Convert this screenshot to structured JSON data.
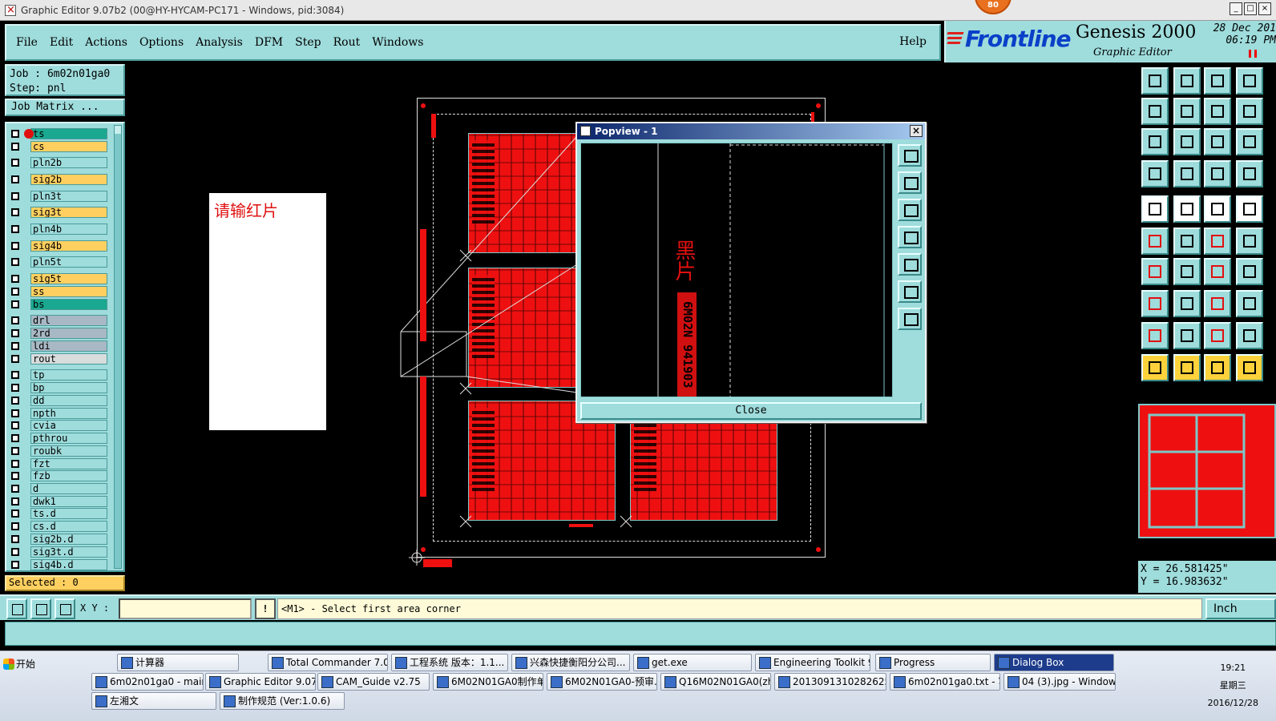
{
  "window": {
    "title": "Graphic Editor 9.07b2 (00@HY-HYCAM-PC171 - Windows, pid:3084)",
    "badge": "80",
    "controls": [
      "_",
      "□",
      "×"
    ]
  },
  "menu": {
    "items": [
      "File",
      "Edit",
      "Actions",
      "Options",
      "Analysis",
      "DFM",
      "Step",
      "Rout",
      "Windows"
    ],
    "help": "Help"
  },
  "branding": {
    "logo": "Frontline",
    "product": "Genesis 2000",
    "subtitle": "Graphic Editor",
    "date": "28 Dec 201",
    "time": "06:19 PM"
  },
  "job": {
    "job_line": "Job : 6m02n01ga0",
    "step_line": "Step: pnl",
    "matrix_button": "Job Matrix ..."
  },
  "layers": [
    {
      "name": "ts",
      "color": "#1aa890"
    },
    {
      "name": "cs",
      "color": "#ffd060"
    },
    {
      "name": "pln2b",
      "color": "#9fdcdc"
    },
    {
      "name": "sig2b",
      "color": "#ffd060"
    },
    {
      "name": "pln3t",
      "color": "#9fdcdc"
    },
    {
      "name": "sig3t",
      "color": "#ffd060"
    },
    {
      "name": "pln4b",
      "color": "#9fdcdc"
    },
    {
      "name": "sig4b",
      "color": "#ffd060"
    },
    {
      "name": "pln5t",
      "color": "#9fdcdc"
    },
    {
      "name": "sig5t",
      "color": "#ffd060"
    },
    {
      "name": "ss",
      "color": "#ffd060"
    },
    {
      "name": "bs",
      "color": "#1aa890"
    },
    {
      "name": "drl",
      "color": "#a8b8c4"
    },
    {
      "name": "2rd",
      "color": "#a8b8c4"
    },
    {
      "name": "ldi",
      "color": "#a8b8c4"
    },
    {
      "name": "rout",
      "color": "#d8dcdc"
    },
    {
      "name": "tp",
      "color": "#9fdcdc"
    },
    {
      "name": "bp",
      "color": "#9fdcdc"
    },
    {
      "name": "dd",
      "color": "#9fdcdc"
    },
    {
      "name": "npth",
      "color": "#9fdcdc"
    },
    {
      "name": "cvia",
      "color": "#9fdcdc"
    },
    {
      "name": "pthrou",
      "color": "#9fdcdc"
    },
    {
      "name": "roubk",
      "color": "#9fdcdc"
    },
    {
      "name": "fzt",
      "color": "#9fdcdc"
    },
    {
      "name": "fzb",
      "color": "#9fdcdc"
    },
    {
      "name": "d",
      "color": "#9fdcdc"
    },
    {
      "name": "dwk1",
      "color": "#9fdcdc"
    },
    {
      "name": "ts.d",
      "color": "#9fdcdc"
    },
    {
      "name": "cs.d",
      "color": "#9fdcdc"
    },
    {
      "name": "sig2b.d",
      "color": "#9fdcdc"
    },
    {
      "name": "sig3t.d",
      "color": "#9fdcdc"
    },
    {
      "name": "sig4b.d",
      "color": "#9fdcdc"
    }
  ],
  "selected": "Selected : 0",
  "note": {
    "text": "请输红片"
  },
  "popview": {
    "title": "Popview - 1",
    "close_label": "Close",
    "vertical_text": "黑片",
    "vertical_code": "6M02N 941903"
  },
  "coords": {
    "x": "X = 26.581425\"",
    "y": "Y = 16.983632\""
  },
  "command": {
    "xy_label": "X Y :",
    "xy_value": "",
    "excl": "!",
    "prompt": "<M1> - Select first area corner",
    "units": "Inch"
  },
  "taskbar": {
    "start": "开始",
    "row1": [
      "计算器",
      "Total Commander 7.0 p...",
      "工程系统   版本：1.1...",
      "兴森快捷衡阳分公司...",
      "get.exe",
      "Engineering Toolkit 9.0...",
      "Progress",
      "Dialog Box"
    ],
    "row2": [
      "6m02n01ga0 - main_qa",
      "Graphic Editor 9.07...",
      "CAM_Guide v2.75",
      "6M02N01GA0制作单...",
      "6M02N01GA0-预审...",
      "Q16M02N01GA0(zho...",
      "20130913102826250...",
      "6m02n01ga0.txt - 写...",
      "04 (3).jpg - Windows..."
    ],
    "row3": [
      "左湘文",
      "制作规范 (Ver:1.0.6)"
    ],
    "active": "Dialog Box",
    "clock_time": "19:21",
    "clock_day": "星期三",
    "clock_date": "2016/12/28"
  }
}
